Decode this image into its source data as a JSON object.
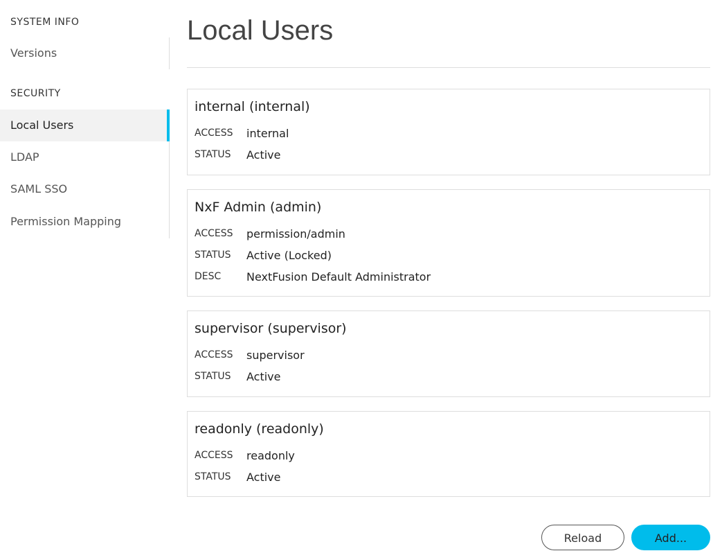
{
  "sidebar": {
    "system_info": {
      "title": "SYSTEM INFO",
      "items": [
        {
          "label": "Versions"
        }
      ]
    },
    "security": {
      "title": "SECURITY",
      "items": [
        {
          "label": "Local Users",
          "active": true
        },
        {
          "label": "LDAP"
        },
        {
          "label": "SAML SSO"
        },
        {
          "label": "Permission Mapping"
        }
      ]
    }
  },
  "main": {
    "title": "Local Users",
    "users": [
      {
        "title": "internal (internal)",
        "fields": [
          {
            "key": "ACCESS",
            "value": "internal"
          },
          {
            "key": "STATUS",
            "value": "Active"
          }
        ]
      },
      {
        "title": "NxF Admin (admin)",
        "fields": [
          {
            "key": "ACCESS",
            "value": "permission/admin"
          },
          {
            "key": "STATUS",
            "value": "Active (Locked)"
          },
          {
            "key": "DESC",
            "value": "NextFusion Default Administrator"
          }
        ]
      },
      {
        "title": "supervisor (supervisor)",
        "fields": [
          {
            "key": "ACCESS",
            "value": "supervisor"
          },
          {
            "key": "STATUS",
            "value": "Active"
          }
        ]
      },
      {
        "title": "readonly (readonly)",
        "fields": [
          {
            "key": "ACCESS",
            "value": "readonly"
          },
          {
            "key": "STATUS",
            "value": "Active"
          }
        ]
      }
    ],
    "buttons": {
      "reload": "Reload",
      "add": "Add..."
    }
  },
  "colors": {
    "accent": "#00bceb",
    "active_bg": "#f2f2f2",
    "border": "#dddddd"
  }
}
